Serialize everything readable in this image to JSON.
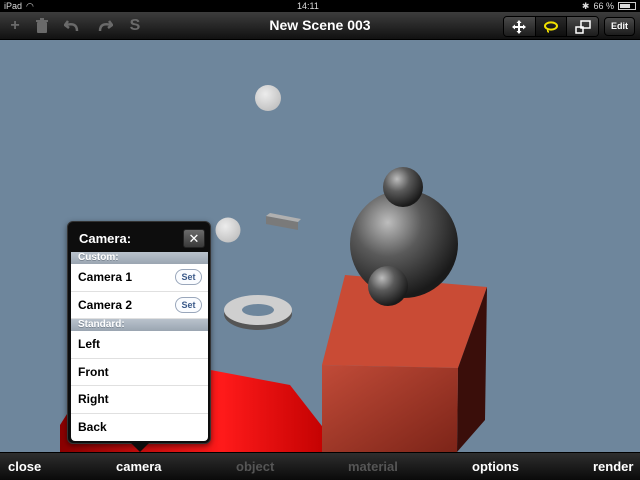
{
  "status_bar": {
    "device": "iPad",
    "time": "14:11",
    "battery": "66 %"
  },
  "toolbar": {
    "title": "New Scene 003",
    "add_icon": "+",
    "trash_icon": "trash-icon",
    "undo_icon": "undo-icon",
    "redo_icon": "redo-icon",
    "s_label": "S",
    "segments": [
      "move-icon",
      "lasso-icon",
      "scale-icon"
    ],
    "edit_label": "Edit"
  },
  "popover": {
    "title": "Camera:",
    "close_label": "✕",
    "sections": [
      {
        "header": "Custom:",
        "rows": [
          {
            "label": "Camera 1",
            "button": "Set"
          },
          {
            "label": "Camera 2",
            "button": "Set"
          }
        ]
      },
      {
        "header": "Standard:",
        "rows": [
          {
            "label": "Left"
          },
          {
            "label": "Front"
          },
          {
            "label": "Right"
          },
          {
            "label": "Back"
          }
        ]
      }
    ]
  },
  "bottom_bar": {
    "tabs": [
      {
        "label": "close",
        "enabled": true
      },
      {
        "label": "camera",
        "enabled": true
      },
      {
        "label": "object",
        "enabled": false
      },
      {
        "label": "material",
        "enabled": false
      },
      {
        "label": "options",
        "enabled": true
      },
      {
        "label": "render",
        "enabled": true
      }
    ]
  },
  "colors": {
    "viewport": "#6e869c",
    "box": "#b84a3a",
    "red_object": "#e01010",
    "sphere": "#4a4a4a"
  }
}
